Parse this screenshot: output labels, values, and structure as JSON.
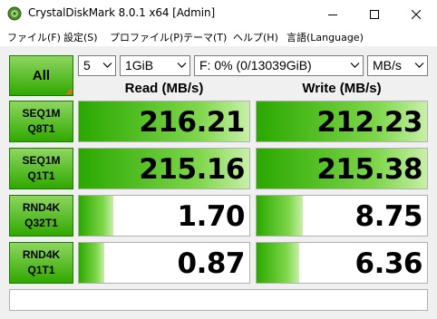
{
  "window": {
    "title": "CrystalDiskMark 8.0.1 x64 [Admin]",
    "controls": {
      "minimize": "minimize-icon",
      "maximize": "maximize-icon",
      "close": "close-icon"
    }
  },
  "menu": [
    "ファイル(F)",
    "設定(S)",
    "プロファイル(P)",
    "テーマ(T)",
    "ヘルプ(H)",
    "言語(Language)"
  ],
  "toolbar": {
    "all_label": "All",
    "count": "5",
    "size": "1GiB",
    "drive": "F: 0% (0/13039GiB)",
    "unit": "MB/s"
  },
  "headers": {
    "read": "Read (MB/s)",
    "write": "Write (MB/s)"
  },
  "rows": [
    {
      "line1": "SEQ1M",
      "line2": "Q8T1",
      "read": "216.21",
      "write": "212.23",
      "read_fill": 1.0,
      "write_fill": 1.0
    },
    {
      "line1": "SEQ1M",
      "line2": "Q1T1",
      "read": "215.16",
      "write": "215.38",
      "read_fill": 1.0,
      "write_fill": 1.0
    },
    {
      "line1": "RND4K",
      "line2": "Q32T1",
      "read": "1.70",
      "write": "8.75",
      "read_fill": 0.2,
      "write_fill": 0.27
    },
    {
      "line1": "RND4K",
      "line2": "Q1T1",
      "read": "0.87",
      "write": "6.36",
      "read_fill": 0.15,
      "write_fill": 0.25
    }
  ],
  "comment": "",
  "colors": {
    "accent_green": "#30a800",
    "bar_green": "#7ed64a",
    "corner_orange": "#e07020"
  }
}
